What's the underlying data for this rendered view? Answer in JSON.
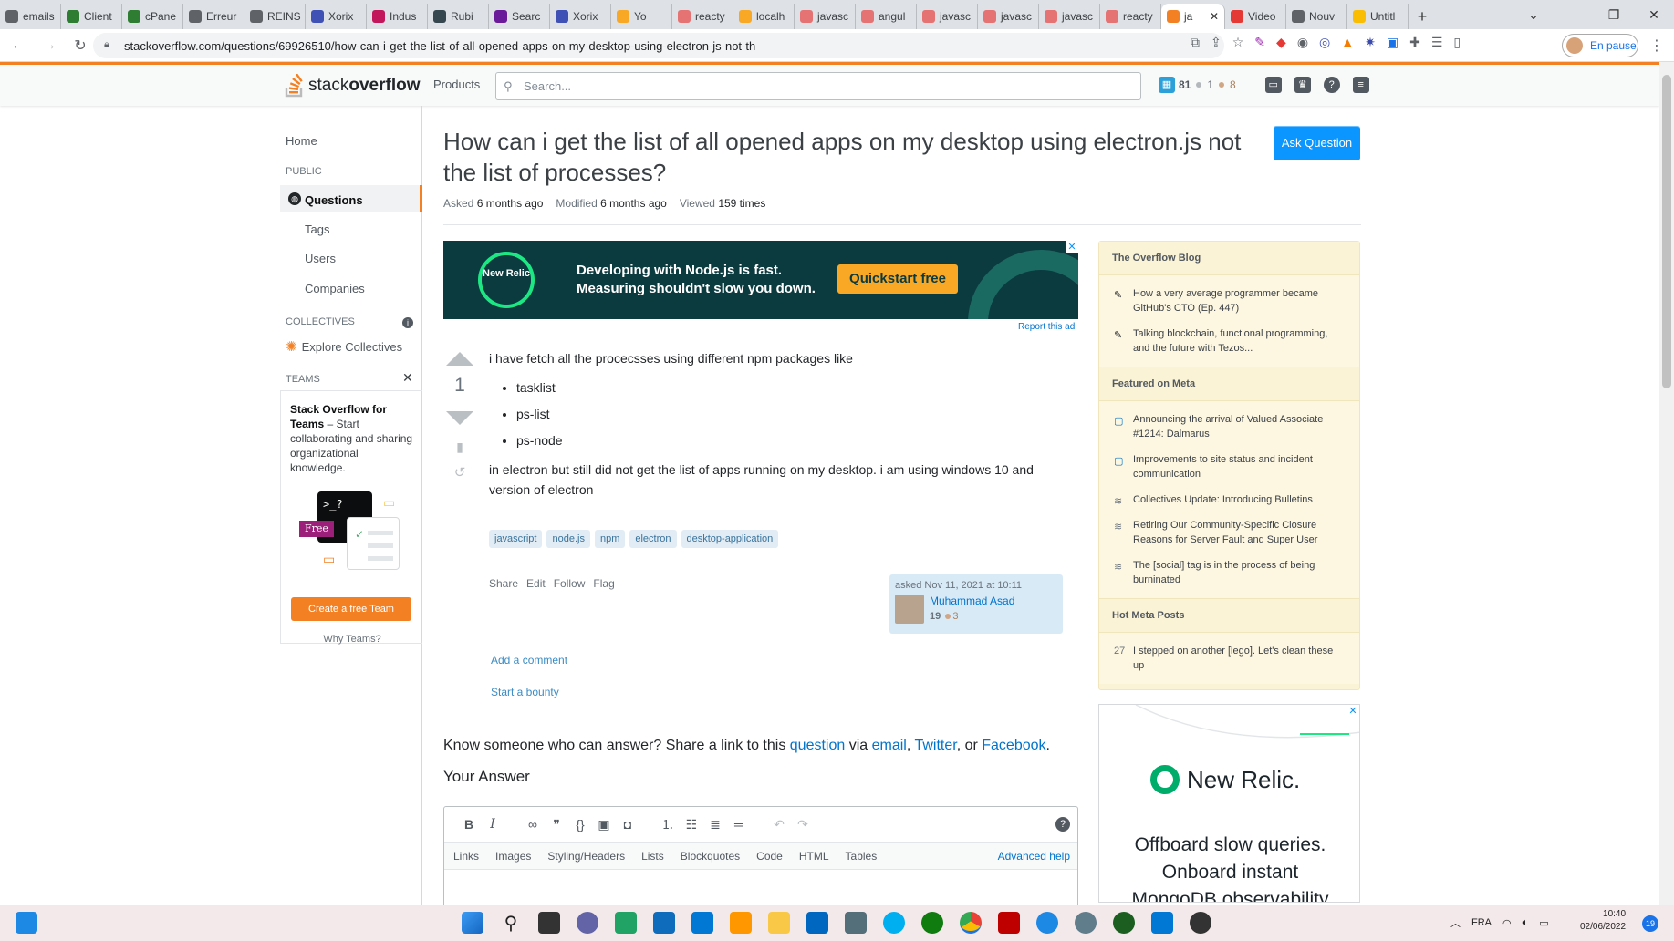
{
  "browser": {
    "tabs": [
      {
        "label": "emails",
        "color": "#5f6368"
      },
      {
        "label": "Client",
        "color": "#2e7d32"
      },
      {
        "label": "cPane",
        "color": "#2e7d32"
      },
      {
        "label": "Erreur",
        "color": "#5f6368"
      },
      {
        "label": "REINS",
        "color": "#5f6368"
      },
      {
        "label": "Xorix",
        "color": "#3f51b5"
      },
      {
        "label": "Indus",
        "color": "#c2185b"
      },
      {
        "label": "Rubi",
        "color": "#37474f"
      },
      {
        "label": "Searc",
        "color": "#6a1b9a"
      },
      {
        "label": "Xorix",
        "color": "#3f51b5"
      },
      {
        "label": "Yo",
        "color": "#f9a825"
      },
      {
        "label": "reacty",
        "color": "#e57373"
      },
      {
        "label": "localh",
        "color": "#f9a825"
      },
      {
        "label": "javasc",
        "color": "#e57373"
      },
      {
        "label": "angul",
        "color": "#e57373"
      },
      {
        "label": "javasc",
        "color": "#e57373"
      },
      {
        "label": "javasc",
        "color": "#e57373"
      },
      {
        "label": "javasc",
        "color": "#e57373"
      },
      {
        "label": "reacty",
        "color": "#e57373"
      },
      {
        "label": "ja",
        "color": "#f48024"
      },
      {
        "label": "Video",
        "color": "#e53935"
      },
      {
        "label": "Nouv",
        "color": "#5f6368"
      },
      {
        "label": "Untitl",
        "color": "#fbbc04"
      }
    ],
    "url": "stackoverflow.com/questions/69926510/how-can-i-get-the-list-of-all-opened-apps-on-my-desktop-using-electron-js-not-th",
    "profile_label": "En pause"
  },
  "so_header": {
    "logo_regular": "stack",
    "logo_bold": "overflow",
    "products": "Products",
    "search_placeholder": "Search...",
    "rep": "81",
    "silver": "1",
    "bronze": "8"
  },
  "leftnav": {
    "home": "Home",
    "public": "PUBLIC",
    "questions": "Questions",
    "tags": "Tags",
    "users": "Users",
    "companies": "Companies",
    "collectives": "COLLECTIVES",
    "explore_collectives": "Explore Collectives",
    "teams": "TEAMS",
    "teams_title": "Stack Overflow for Teams",
    "teams_desc": " – Start collaborating and sharing organizational knowledge.",
    "free_badge": "Free",
    "create_team": "Create a free Team",
    "why_teams": "Why Teams?"
  },
  "question": {
    "title": "How can i get the list of all opened apps on my desktop using electron.js not the list of processes?",
    "ask_button": "Ask Question",
    "asked_label": "Asked",
    "asked_value": "6 months ago",
    "modified_label": "Modified",
    "modified_value": "6 months ago",
    "viewed_label": "Viewed",
    "viewed_value": "159 times",
    "votes": "1",
    "body_intro": "i have fetch all the procecsses using different npm packages like",
    "body_list": [
      "tasklist",
      "ps-list",
      "ps-node"
    ],
    "body_outro": "in electron but still did not get the list of apps running on my desktop. i am using windows 10 and version of electron",
    "tags": [
      "javascript",
      "node.js",
      "npm",
      "electron",
      "desktop-application"
    ],
    "menu": [
      "Share",
      "Edit",
      "Follow",
      "Flag"
    ],
    "asked_on": "asked Nov 11, 2021 at 10:11",
    "owner_name": "Muhammad Asad",
    "owner_rep": "19",
    "owner_bronze": "3",
    "add_comment": "Add a comment",
    "start_bounty": "Start a bounty"
  },
  "ad_top": {
    "logo_text": "New Relic",
    "line1": "Developing with Node.js is fast.",
    "line2": "Measuring shouldn't slow you down.",
    "cta": "Quickstart free",
    "report": "Report this ad"
  },
  "share": {
    "prefix": "Know someone who can answer? Share a link to this ",
    "question_link": "question",
    "via": " via ",
    "email": "email",
    "twitter": "Twitter",
    "or": ", or ",
    "facebook": "Facebook"
  },
  "answer": {
    "heading": "Your Answer",
    "help_tabs": [
      "Links",
      "Images",
      "Styling/Headers",
      "Lists",
      "Blockquotes",
      "Code",
      "HTML",
      "Tables"
    ],
    "advanced_help": "Advanced help"
  },
  "sidebar": {
    "blog_title": "The Overflow Blog",
    "blog_items": [
      "How a very average programmer became GitHub's CTO (Ep. 447)",
      "Talking blockchain, functional programming, and the future with Tezos..."
    ],
    "meta_title": "Featured on Meta",
    "meta_items": [
      "Announcing the arrival of Valued Associate #1214: Dalmarus",
      "Improvements to site status and incident communication",
      "Collectives Update: Introducing Bulletins",
      "Retiring Our Community-Specific Closure Reasons for Server Fault and Super User",
      "The [social] tag is in the process of being burninated"
    ],
    "hot_title": "Hot Meta Posts",
    "hot_count": "27",
    "hot_item": "I stepped on another [lego]. Let's clean these up"
  },
  "ad_side": {
    "logo": "New Relic.",
    "line1": "Offboard slow queries.",
    "line2": "Onboard instant",
    "line3": "MongoDB observability"
  },
  "taskbar": {
    "lang": "FRA",
    "time": "10:40",
    "date": "02/06/2022",
    "notif": "19"
  }
}
